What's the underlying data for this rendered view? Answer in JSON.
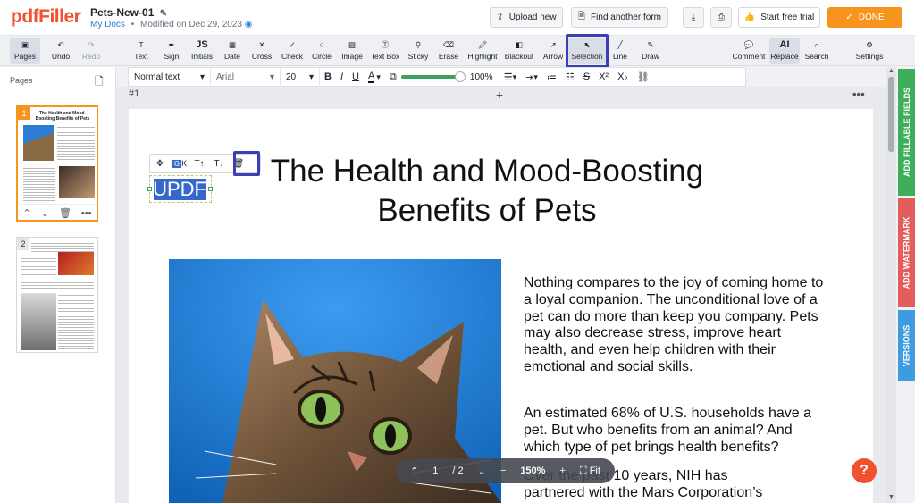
{
  "header": {
    "logo": "pdfFiller",
    "doc_name": "Pets-New-01",
    "folder": "My Docs",
    "modified": "Modified on Dec 29, 2023",
    "upload_label": "Upload new",
    "find_label": "Find another form",
    "trial_label": "Start free trial",
    "done_label": "DONE"
  },
  "toolbar": {
    "pages": "Pages",
    "undo": "Undo",
    "redo": "Redo",
    "text": "Text",
    "sign": "Sign",
    "initials": "Initials",
    "date": "Date",
    "cross": "Cross",
    "check": "Check",
    "circle": "Circle",
    "image": "Image",
    "textbox": "Text Box",
    "sticky": "Sticky",
    "erase": "Erase",
    "highlight": "Highlight",
    "blackout": "Blackout",
    "arrow": "Arrow",
    "selection": "Selection",
    "line": "Line",
    "draw": "Draw",
    "comment": "Comment",
    "replace": "Replace",
    "search": "Search",
    "settings": "Settings"
  },
  "format": {
    "style": "Normal text",
    "font": "Arial",
    "size": "20",
    "zoom": "100%",
    "opacity": 1.0
  },
  "left": {
    "pages_title": "Pages",
    "page1_title": "The Health and Mood-Boosting Benefits of Pets",
    "page1_num": "1",
    "page2_num": "2"
  },
  "canvas": {
    "page_label": "#1",
    "title": "The Health and Mood-Boosting Benefits of Pets",
    "updf": "UPDF",
    "p1": "Nothing compares to the joy of coming home to a loyal companion. The unconditional love of a pet can do more than keep you company. Pets may also decrease stress, improve heart health,  and  even  help children  with  their emotional and social skills.",
    "p2": "An estimated 68% of U.S. households have a pet. But who benefits from an animal? And which type of pet brings health benefits?",
    "p3a": "Over  the  past  10  years,  NIH  has",
    "p3b": "partnered with the Mars Corporation’s"
  },
  "zoom": {
    "page_current": "1",
    "page_total": "/ 2",
    "zoom_level": "150%",
    "fit": "Fit"
  },
  "sidetabs": {
    "fillable": "ADD FILLABLE FIELDS",
    "watermark": "ADD WATERMARK",
    "versions": "VERSIONS"
  },
  "colors": {
    "accent": "#f7941d",
    "brand": "#f0512e",
    "highlight_box": "#3b3fb6",
    "fillable_tab": "#3fae5b",
    "watermark_tab": "#e35d5d",
    "versions_tab": "#3e9be0"
  }
}
